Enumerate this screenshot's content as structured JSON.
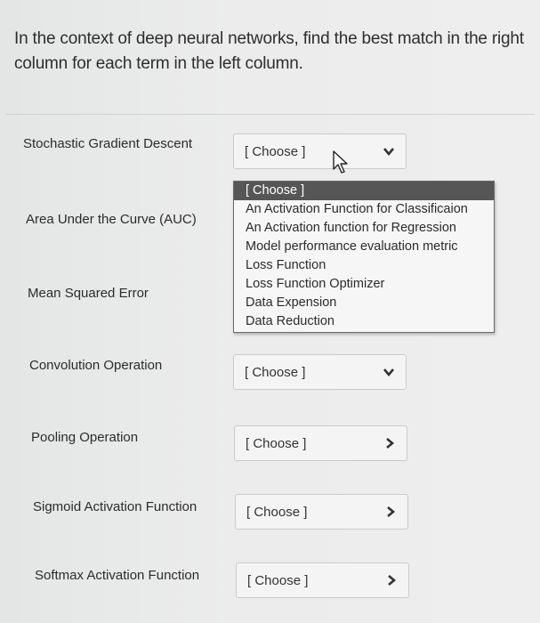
{
  "question": "In the context of deep neural networks, find the best match in the right column for each term in the left column.",
  "rows": [
    {
      "term": "Stochastic Gradient Descent",
      "selected": "[ Choose ]"
    },
    {
      "term": "Area Under the Curve (AUC)",
      "selected": "[ Choose ]"
    },
    {
      "term": "Mean Squared Error",
      "selected": "[ Choose ]"
    },
    {
      "term": "Convolution Operation",
      "selected": "[ Choose ]"
    },
    {
      "term": "Pooling Operation",
      "selected": "[ Choose ]"
    },
    {
      "term": "Sigmoid Activation Function",
      "selected": "[ Choose ]"
    },
    {
      "term": "Softmax Activation Function",
      "selected": "[ Choose ]"
    }
  ],
  "dropdown": {
    "options": [
      "[ Choose ]",
      "An Activation Function for Classificaion",
      "An Activation function for Regression",
      "Model performance evaluation metric",
      "Loss Function",
      "Loss Function Optimizer",
      "Data Expension",
      "Data Reduction"
    ],
    "highlighted_index": 0
  },
  "icons": {
    "select_arrow": "chevron-down-icon",
    "pointer": "mouse-pointer-icon"
  },
  "colors": {
    "highlight": "#565656",
    "background": "#ececec"
  }
}
